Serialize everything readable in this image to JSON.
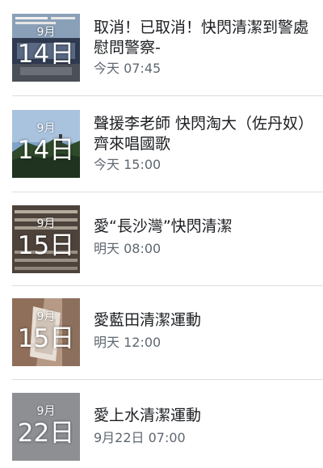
{
  "events": [
    {
      "month": "9月",
      "day": "14日",
      "title": "取消！已取消！快閃清潔到警處慰問警察-",
      "time": "今天 07:45"
    },
    {
      "month": "9月",
      "day": "14日",
      "title": "聲援李老師 快閃淘大（佐丹奴）齊來唱國歌",
      "time": "今天 15:00"
    },
    {
      "month": "9月",
      "day": "15日",
      "title": "愛“長沙灣”快閃清潔",
      "time": "明天 08:00"
    },
    {
      "month": "9月",
      "day": "15日",
      "title": "愛藍田清潔運動",
      "time": "明天 12:00"
    },
    {
      "month": "9月",
      "day": "22日",
      "title": "愛上水清潔運動",
      "time": "9月22日 07:00"
    }
  ]
}
